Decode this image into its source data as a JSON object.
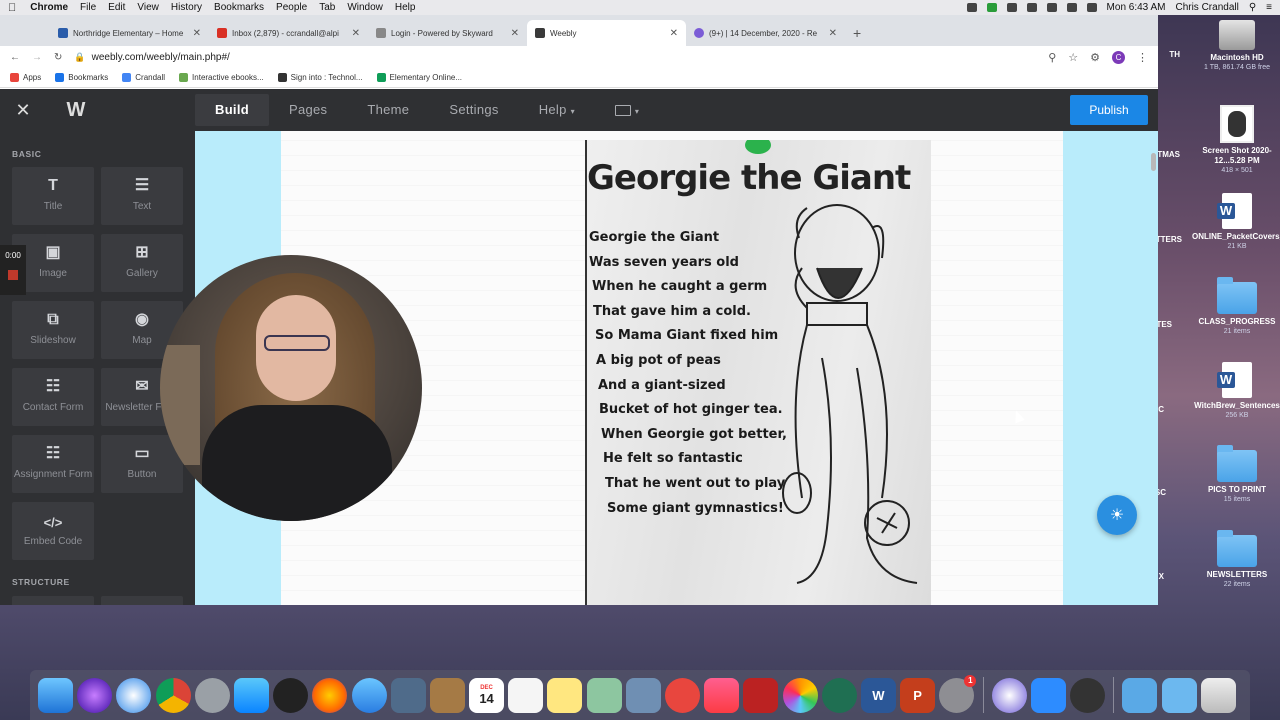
{
  "menubar": {
    "app": "Chrome",
    "items": [
      "File",
      "Edit",
      "View",
      "History",
      "Bookmarks",
      "People",
      "Tab",
      "Window",
      "Help"
    ],
    "clock": "Mon 6:43 AM",
    "user": "Chris Crandall"
  },
  "tabs": [
    {
      "title": "Northridge Elementary – Home",
      "color": "#2a5caa"
    },
    {
      "title": "Inbox (2,879) - ccrandall@alpi",
      "color": "#d93025"
    },
    {
      "title": "Login - Powered by Skyward",
      "color": "#888888"
    },
    {
      "title": "Weebly",
      "color": "#3a3a3a"
    },
    {
      "title": "(9+) | 14 December, 2020 - Re",
      "color": "#7b5cd6"
    }
  ],
  "address": {
    "url": "weebly.com/weebly/main.php#/",
    "avatar": "C"
  },
  "bookmarks": [
    {
      "label": "Apps",
      "color": "#e8453c"
    },
    {
      "label": "Bookmarks",
      "color": "#1a73e8"
    },
    {
      "label": "Crandall",
      "color": "#4285f4"
    },
    {
      "label": "Interactive ebooks...",
      "color": "#6aa84f"
    },
    {
      "label": "Sign into : Technol...",
      "color": "#333333"
    },
    {
      "label": "Elementary Online...",
      "color": "#0f9d58"
    }
  ],
  "weebly": {
    "nav": [
      "Build",
      "Pages",
      "Theme",
      "Settings",
      "Help"
    ],
    "publish": "Publish",
    "sections": {
      "basic": "BASIC",
      "structure": "STRUCTURE"
    },
    "elements": [
      {
        "label": "Title",
        "glyph": "T"
      },
      {
        "label": "Text",
        "glyph": "☰"
      },
      {
        "label": "Image",
        "glyph": "▣"
      },
      {
        "label": "Gallery",
        "glyph": "⊞"
      },
      {
        "label": "Slideshow",
        "glyph": "⧉"
      },
      {
        "label": "Map",
        "glyph": "◉"
      },
      {
        "label": "Contact Form",
        "glyph": "☷"
      },
      {
        "label": "Newsletter Form",
        "glyph": "✉"
      },
      {
        "label": "Assignment Form",
        "glyph": "☷"
      },
      {
        "label": "Button",
        "glyph": "▭"
      },
      {
        "label": "Embed Code",
        "glyph": "</>"
      }
    ]
  },
  "recorder": {
    "time": "0:00"
  },
  "poem": {
    "title": "Georgie the Giant",
    "lines": [
      "Georgie the Giant",
      "Was seven years old",
      "When he caught a germ",
      "That gave him a cold.",
      "So Mama Giant fixed him",
      "A big pot of peas",
      "And a giant-sized",
      "Bucket of hot ginger tea.",
      "When Georgie got better,",
      "He felt so fantastic",
      "That he went out to play",
      "Some giant gymnastics!"
    ]
  },
  "desktop": [
    {
      "label": "Macintosh HD",
      "sub": "1 TB, 861.74 GB free",
      "kind": "hdd"
    },
    {
      "label": "Screen Shot 2020-12...5.28 PM",
      "sub": "418 × 501",
      "kind": "shot"
    },
    {
      "label": "ONLINE_PacketCovers_Oct26",
      "sub": "21 KB",
      "kind": "word"
    },
    {
      "label": "CLASS_PROGRESS",
      "sub": "21 items",
      "kind": "folder"
    },
    {
      "label": "WitchBrew_Sentences",
      "sub": "256 KB",
      "kind": "word"
    },
    {
      "label": "PICS TO PRINT",
      "sub": "15 items",
      "kind": "folder"
    },
    {
      "label": "NEWSLETTERS",
      "sub": "22 items",
      "kind": "folder"
    }
  ],
  "desktop_partial": [
    "TH",
    "TMAS",
    "ETTERS",
    "TES",
    "C",
    "SC",
    "X"
  ],
  "dock": {
    "calendar_month": "DEC",
    "calendar_day": "14",
    "word": "W",
    "powerpoint": "P",
    "badge": "1"
  }
}
